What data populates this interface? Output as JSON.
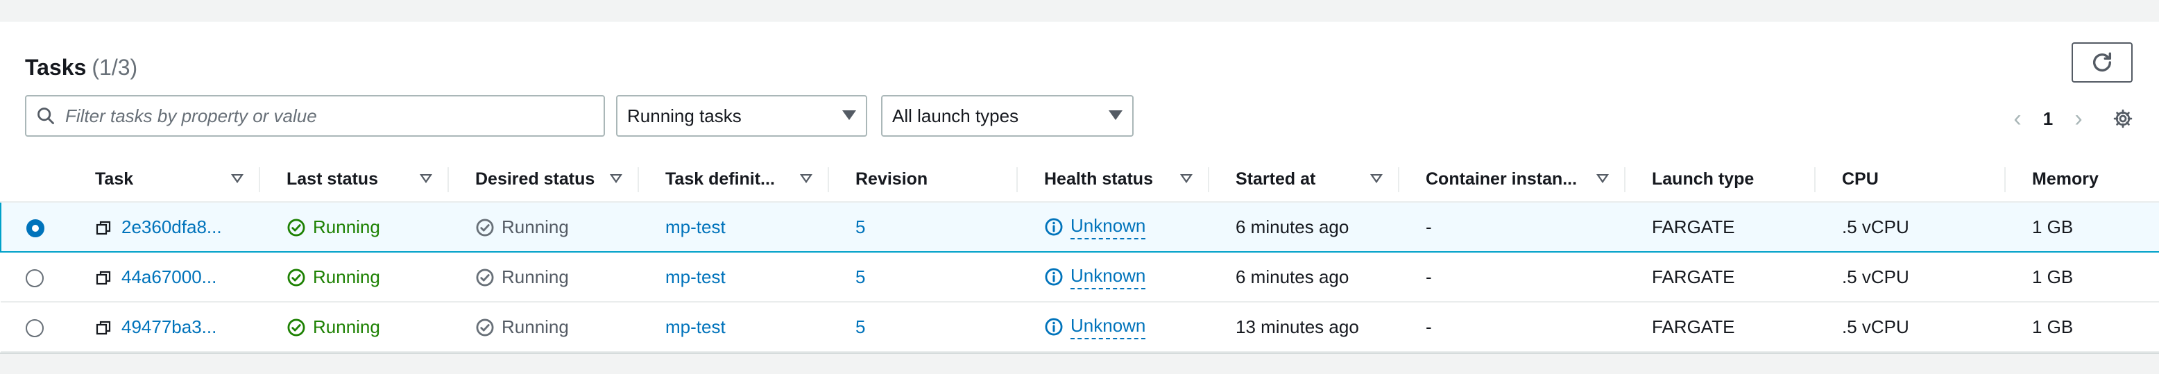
{
  "header": {
    "title": "Tasks",
    "count": "(1/3)"
  },
  "search": {
    "placeholder": "Filter tasks by property or value"
  },
  "filters": {
    "status": "Running tasks",
    "launch": "All launch types"
  },
  "pagination": {
    "page": "1"
  },
  "columns": [
    "Task",
    "Last status",
    "Desired status",
    "Task definit...",
    "Revision",
    "Health status",
    "Started at",
    "Container instan...",
    "Launch type",
    "CPU",
    "Memory"
  ],
  "rows": [
    {
      "task": "2e360dfa8...",
      "last": "Running",
      "desired": "Running",
      "def": "mp-test",
      "rev": "5",
      "health": "Unknown",
      "started": "6 minutes ago",
      "container": "-",
      "launch": "FARGATE",
      "cpu": ".5 vCPU",
      "mem": "1 GB",
      "selected": true
    },
    {
      "task": "44a67000...",
      "last": "Running",
      "desired": "Running",
      "def": "mp-test",
      "rev": "5",
      "health": "Unknown",
      "started": "6 minutes ago",
      "container": "-",
      "launch": "FARGATE",
      "cpu": ".5 vCPU",
      "mem": "1 GB",
      "selected": false
    },
    {
      "task": "49477ba3...",
      "last": "Running",
      "desired": "Running",
      "def": "mp-test",
      "rev": "5",
      "health": "Unknown",
      "started": "13 minutes ago",
      "container": "-",
      "launch": "FARGATE",
      "cpu": ".5 vCPU",
      "mem": "1 GB",
      "selected": false
    }
  ],
  "colors": {
    "link": "#0073bb",
    "success": "#1d8102",
    "muted": "#545b64",
    "selected_border": "#00a1c9"
  },
  "icons": {
    "refresh": "refresh-icon",
    "search": "search-icon",
    "settings": "gear-icon",
    "prev": "chevron-left-icon",
    "next": "chevron-right-icon"
  }
}
